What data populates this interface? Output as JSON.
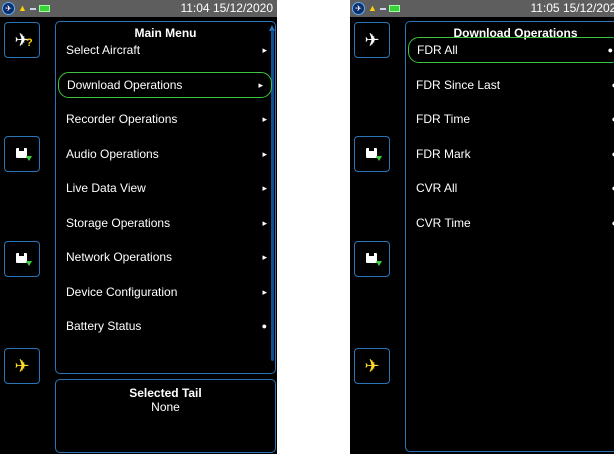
{
  "left_screen": {
    "status": {
      "time": "11:04 15/12/2020"
    },
    "menu": {
      "title": "Main Menu",
      "items": [
        {
          "label": "Select Aircraft",
          "marker": "▸"
        },
        {
          "label": "Download Operations",
          "marker": "▸",
          "selected": true
        },
        {
          "label": "Recorder Operations",
          "marker": "▸"
        },
        {
          "label": "Audio Operations",
          "marker": "▸"
        },
        {
          "label": "Live Data View",
          "marker": "▸"
        },
        {
          "label": "Storage Operations",
          "marker": "▸"
        },
        {
          "label": "Network Operations",
          "marker": "▸"
        },
        {
          "label": "Device Configuration",
          "marker": "▸"
        },
        {
          "label": "Battery Status",
          "marker": "●"
        }
      ]
    },
    "tail": {
      "title": "Selected Tail",
      "value": "None"
    }
  },
  "right_screen": {
    "status": {
      "time": "11:05 15/12/2020"
    },
    "menu": {
      "title": "Download Operations",
      "items": [
        {
          "label": "FDR All",
          "marker": "●",
          "selected": true
        },
        {
          "label": "FDR Since Last",
          "marker": "●"
        },
        {
          "label": "FDR Time",
          "marker": "●"
        },
        {
          "label": "FDR Mark",
          "marker": "●"
        },
        {
          "label": "CVR All",
          "marker": "●"
        },
        {
          "label": "CVR Time",
          "marker": "●"
        }
      ]
    }
  },
  "side_buttons": [
    {
      "icon": "airplane-question-icon"
    },
    {
      "icon": "save-download-icon"
    },
    {
      "icon": "save-download-icon"
    },
    {
      "icon": "airplane-icon",
      "color": "#ffdb2c"
    }
  ],
  "colors": {
    "panel_border": "#2a74b8",
    "selection_border": "#3ec33e",
    "status_bar": "#5e5e5e",
    "background": "#000000"
  }
}
